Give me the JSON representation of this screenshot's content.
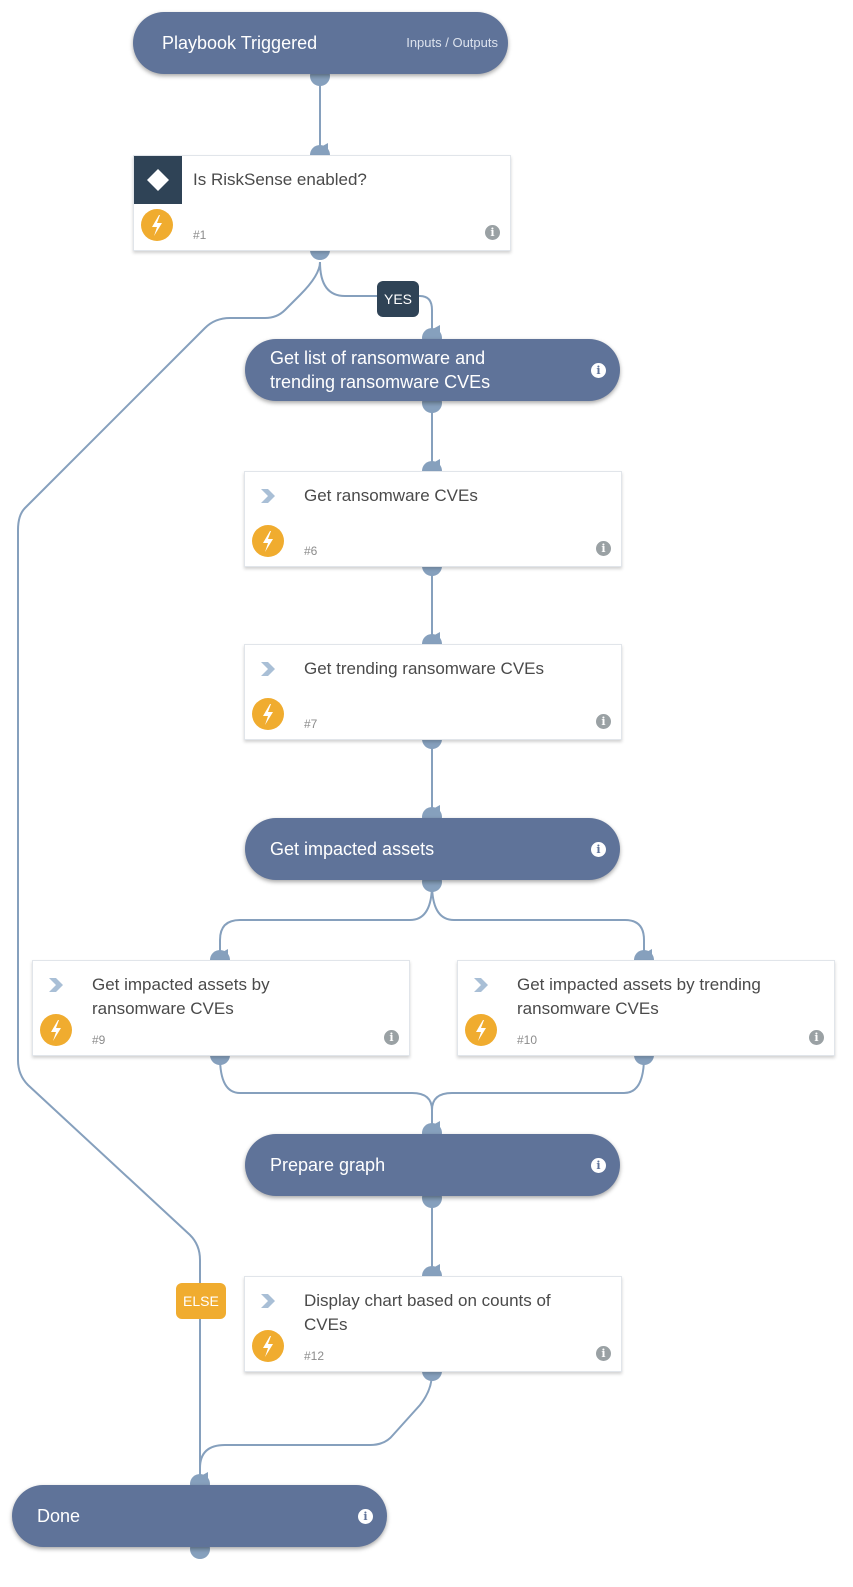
{
  "playbook": {
    "start": {
      "title": "Playbook Triggered",
      "io_link": "Inputs / Outputs"
    },
    "condition": {
      "title": "Is RiskSense enabled?",
      "number": "#1",
      "icon": "diamond-icon"
    },
    "branches": {
      "yes": "YES",
      "else": "ELSE"
    },
    "sections": [
      {
        "title_line1": "Get list of ransomware and",
        "title_line2": "trending ransomware CVEs"
      },
      {
        "title": "Get impacted assets"
      },
      {
        "title": "Prepare graph"
      },
      {
        "title": "Done"
      }
    ],
    "tasks": [
      {
        "title": "Get ransomware CVEs",
        "number": "#6"
      },
      {
        "title": "Get trending ransomware CVEs",
        "number": "#7"
      },
      {
        "title": "Get impacted assets by ransomware CVEs",
        "number": "#9"
      },
      {
        "title": "Get impacted assets by trending ransomware CVEs",
        "number": "#10"
      },
      {
        "title": "Display chart based on counts of CVEs",
        "number": "#12"
      }
    ],
    "info_glyph": "i",
    "colors": {
      "section": "#5f7399",
      "connector": "#86a0bd",
      "condition_box": "#2f4356",
      "automation_badge": "#f0ac2f",
      "yes_badge": "#2f4356",
      "else_badge": "#f0ac2f"
    }
  }
}
